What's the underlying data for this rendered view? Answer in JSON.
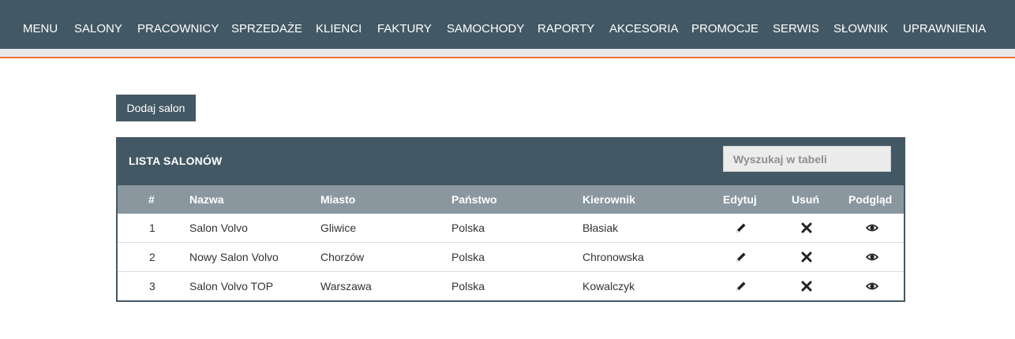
{
  "nav": {
    "items": [
      {
        "label": "MENU"
      },
      {
        "label": "SALONY"
      },
      {
        "label": "PRACOWNICY"
      },
      {
        "label": "SPRZEDAŻE"
      },
      {
        "label": "KLIENCI"
      },
      {
        "label": "FAKTURY"
      },
      {
        "label": "SAMOCHODY"
      },
      {
        "label": "RAPORTY"
      },
      {
        "label": "AKCESORIA"
      },
      {
        "label": "PROMOCJE"
      },
      {
        "label": "SERWIS"
      },
      {
        "label": "SŁOWNIK"
      },
      {
        "label": "UPRAWNIENIA"
      }
    ]
  },
  "actions": {
    "add_label": "Dodaj salon"
  },
  "panel": {
    "title": "LISTA SALONÓW",
    "search_placeholder": "Wyszukaj w tabeli"
  },
  "table": {
    "columns": [
      "#",
      "Nazwa",
      "Miasto",
      "Państwo",
      "Kierownik",
      "Edytuj",
      "Usuń",
      "Podgląd"
    ],
    "rows": [
      {
        "id": "1",
        "name": "Salon Volvo",
        "city": "Gliwice",
        "country": "Polska",
        "manager": "Błasiak"
      },
      {
        "id": "2",
        "name": "Nowy Salon Volvo",
        "city": "Chorzów",
        "country": "Polska",
        "manager": "Chronowska"
      },
      {
        "id": "3",
        "name": "Salon Volvo TOP",
        "city": "Warszawa",
        "country": "Polska",
        "manager": "Kowalczyk"
      }
    ]
  },
  "icons": {
    "edit": "pencil-icon",
    "delete": "close-icon",
    "view": "eye-icon"
  },
  "colors": {
    "primary": "#435865",
    "accent": "#e8703a",
    "table_header": "#8a979f"
  }
}
